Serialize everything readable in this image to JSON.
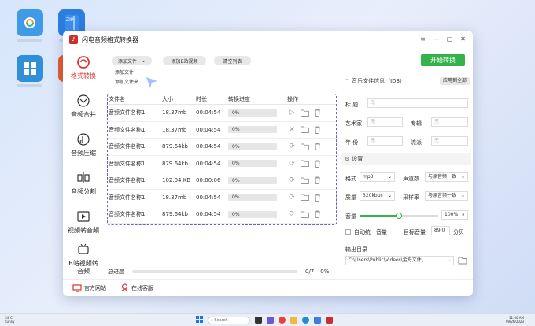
{
  "window": {
    "title": "闪电音频格式转换器",
    "logo_icon": "music-note-icon"
  },
  "sidebar": {
    "items": [
      {
        "label": "格式转换",
        "icon": "convert-icon"
      },
      {
        "label": "音频合并",
        "icon": "merge-icon"
      },
      {
        "label": "音频压缩",
        "icon": "compress-icon"
      },
      {
        "label": "音频分割",
        "icon": "split-icon"
      },
      {
        "label": "视频转音频",
        "icon": "video-icon"
      },
      {
        "label": "B站视频转音频",
        "icon": "bilibili-icon"
      }
    ]
  },
  "toolbar": {
    "add_file": "添加文件",
    "add_video": "添加B站视频",
    "clear_list": "清空列表",
    "start": "开始转换"
  },
  "dropdown": {
    "items": [
      "添加文件",
      "添加文件夹"
    ]
  },
  "file_list": {
    "headers": [
      "文件名",
      "大小",
      "时长",
      "转换进度",
      "操作"
    ],
    "rows": [
      {
        "name": "音频文件名称1",
        "size": "18.37mb",
        "duration": "00:04:54",
        "progress": "0%"
      },
      {
        "name": "音频文件名称1",
        "size": "18.37mb",
        "duration": "00:04:54",
        "progress": "0%"
      },
      {
        "name": "音频文件名称1",
        "size": "879.64kb",
        "duration": "00:04:54",
        "progress": "0%"
      },
      {
        "name": "音频文件名称1",
        "size": "879.64kb",
        "duration": "00:04:54",
        "progress": "0%"
      },
      {
        "name": "音频文件名称1",
        "size": "102.04 KB",
        "duration": "00:00:06",
        "progress": "0%"
      },
      {
        "name": "音频文件名称1",
        "size": "18.37mb",
        "duration": "00:04:54",
        "progress": "0%"
      },
      {
        "name": "音频文件名称1",
        "size": "879.64kb",
        "duration": "00:04:54",
        "progress": "0%"
      }
    ]
  },
  "total_progress": {
    "label": "总进度",
    "count": "0/7",
    "percent": "0%"
  },
  "footer": {
    "website": "官方网站",
    "service": "在线客服"
  },
  "right_panel": {
    "info_title": "音乐文件信息（ID3）",
    "apply_all": "应用到全部",
    "title_label": "标   题",
    "artist_label": "艺术家",
    "album_label": "专辑",
    "year_label": "年   份",
    "genre_label": "流派",
    "none": "无",
    "settings_title": "设置",
    "format_label": "格式",
    "format_value": "mp3",
    "channel_label": "声道数",
    "channel_value": "与原音频一致",
    "quality_label": "质量",
    "quality_value": "320kbps",
    "samplerate_label": "采样率",
    "samplerate_value": "与原音频一致",
    "volume_label": "音量",
    "volume_value": "100%",
    "volume_level": 0.5,
    "auto_volume_label": "自动统一音量",
    "target_volume_label": "目标音量",
    "target_volume_value": "89.0",
    "target_volume_unit": "分贝",
    "output_label": "输出目录",
    "output_path": "C:\\Users\\Public\\Videos\\金舟文件\\"
  },
  "taskbar": {
    "weather_temp": "34°C",
    "weather_desc": "Sunny",
    "search": "Search",
    "time": "11:00 AM",
    "date": "09/26/2023"
  },
  "colors": {
    "accent_red": "#d33333",
    "start_green": "#36b24a",
    "dash_purple": "#6c57e0"
  }
}
